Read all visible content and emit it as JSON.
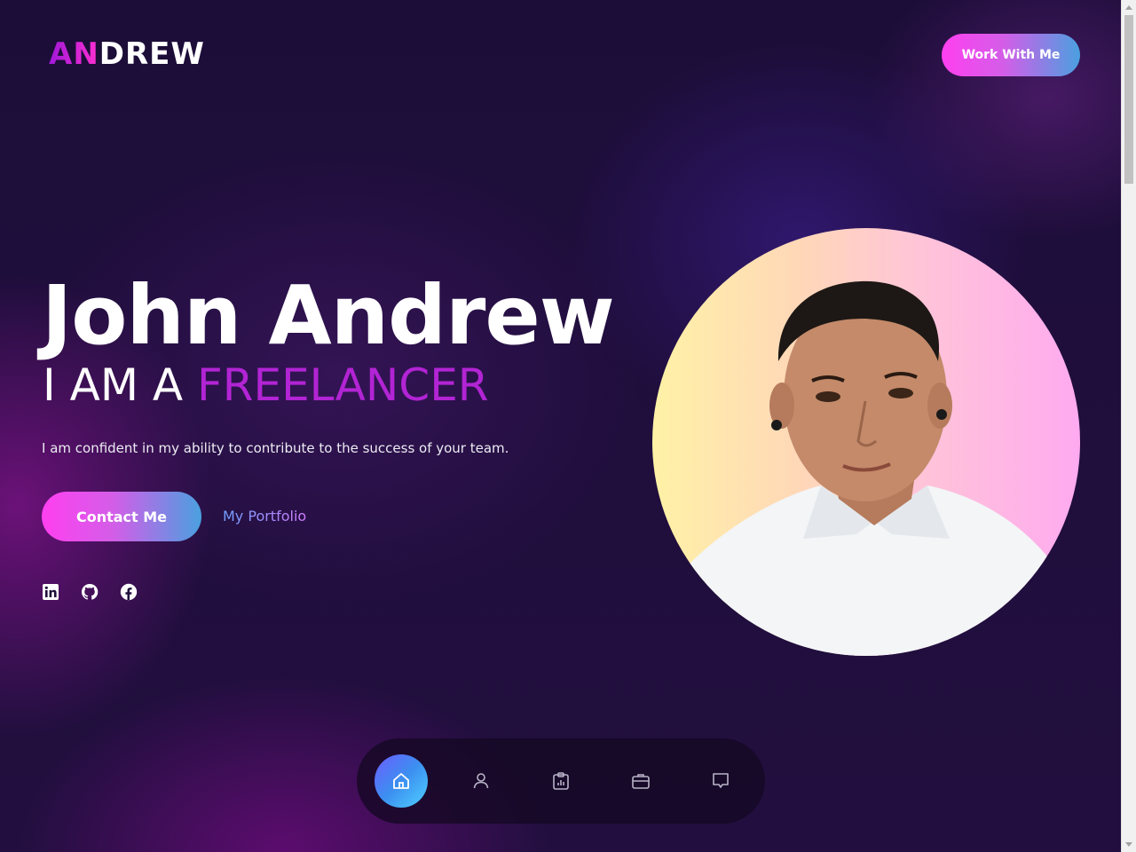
{
  "header": {
    "logo_part1": "AN",
    "logo_part2": "DREW",
    "cta_label": "Work With Me"
  },
  "hero": {
    "name": "John Andrew",
    "role_prefix": "I AM A ",
    "role_highlight": "FREELANCER",
    "description": "I am confident in my ability to contribute to the success of your team.",
    "contact_label": "Contact Me",
    "portfolio_label": "My Portfolio"
  },
  "socials": [
    {
      "icon": "linkedin-icon"
    },
    {
      "icon": "github-icon"
    },
    {
      "icon": "facebook-icon"
    }
  ],
  "bottom_nav": [
    {
      "icon": "home-icon",
      "active": true
    },
    {
      "icon": "user-icon",
      "active": false
    },
    {
      "icon": "clipboard-chart-icon",
      "active": false
    },
    {
      "icon": "briefcase-icon",
      "active": false
    },
    {
      "icon": "message-icon",
      "active": false
    }
  ],
  "colors": {
    "accent": "#b224d4",
    "gradient_start": "#ff3ff0",
    "gradient_end": "#4aa0e0",
    "background": "#1f0e3c"
  }
}
